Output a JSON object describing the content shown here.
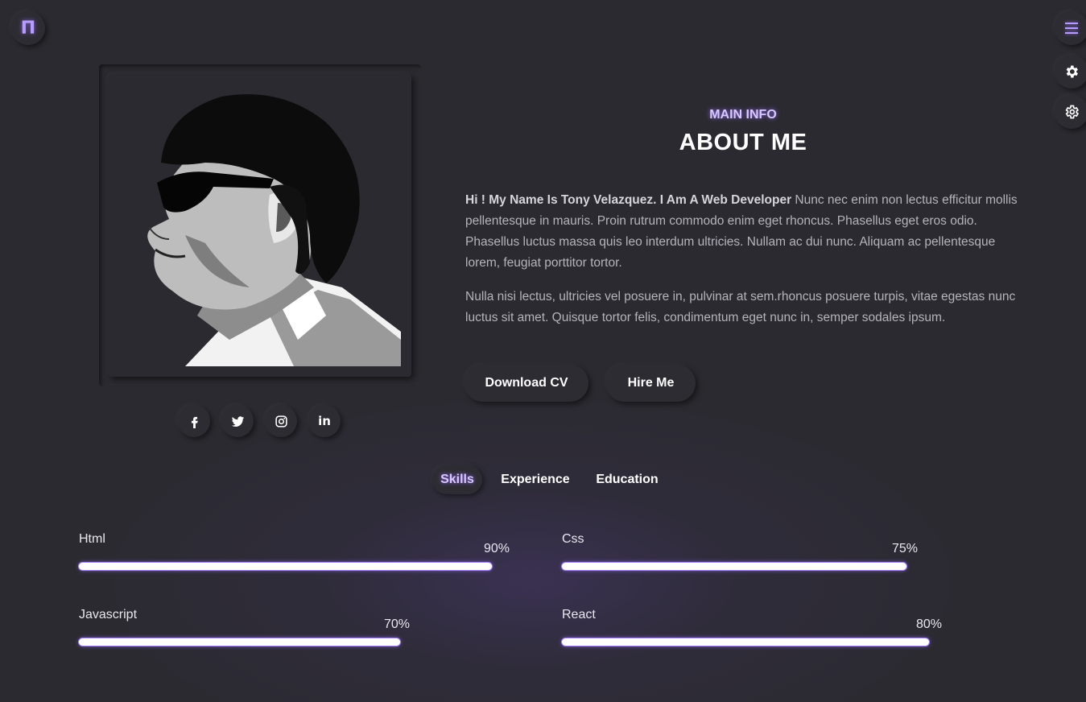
{
  "nav": {
    "logo_glyph": "Π",
    "icons": [
      "menu-icon",
      "settings-icon",
      "gear-icon"
    ]
  },
  "social": {
    "icons": [
      "facebook-icon",
      "twitter-icon",
      "instagram-icon",
      "linkedin-icon"
    ],
    "linkedin_text": "in"
  },
  "about": {
    "subtitle": "MAIN INFO",
    "title": "ABOUT ME",
    "intro_bold": "Hi ! My Name Is Tony Velazquez. I Am A Web Developer",
    "intro_rest": " Nunc nec enim non lectus efficitur mollis pellentesque in mauris. Proin rutrum commodo enim eget rhoncus. Phasellus eget eros odio. Phasellus luctus massa quis leo interdum ultricies. Nullam ac dui nunc. Aliquam ac pellentesque lorem, feugiat porttitor tortor.",
    "paragraph2": "Nulla nisi lectus, ultricies vel posuere in, pulvinar at sem.rhoncus posuere turpis, vitae egestas nunc luctus sit amet. Quisque tortor felis, condimentum eget nunc in, semper sodales ipsum."
  },
  "buttons": {
    "download_cv": "Download CV",
    "hire_me": "Hire Me"
  },
  "tabs": [
    {
      "label": "Skills",
      "active": true
    },
    {
      "label": "Experience",
      "active": false
    },
    {
      "label": "Education",
      "active": false
    }
  ],
  "skills": [
    {
      "name": "Html",
      "percent_label": "90%",
      "level": 0.9
    },
    {
      "name": "Css",
      "percent_label": "75%",
      "level": 0.75
    },
    {
      "name": "Javascript",
      "percent_label": "70%",
      "level": 0.7
    },
    {
      "name": "React",
      "percent_label": "80%",
      "level": 0.8
    }
  ],
  "colors": {
    "background": "#2b2a30",
    "accent": "#b79cff",
    "text": "#ffffff",
    "muted_text": "#b5b4bc"
  }
}
